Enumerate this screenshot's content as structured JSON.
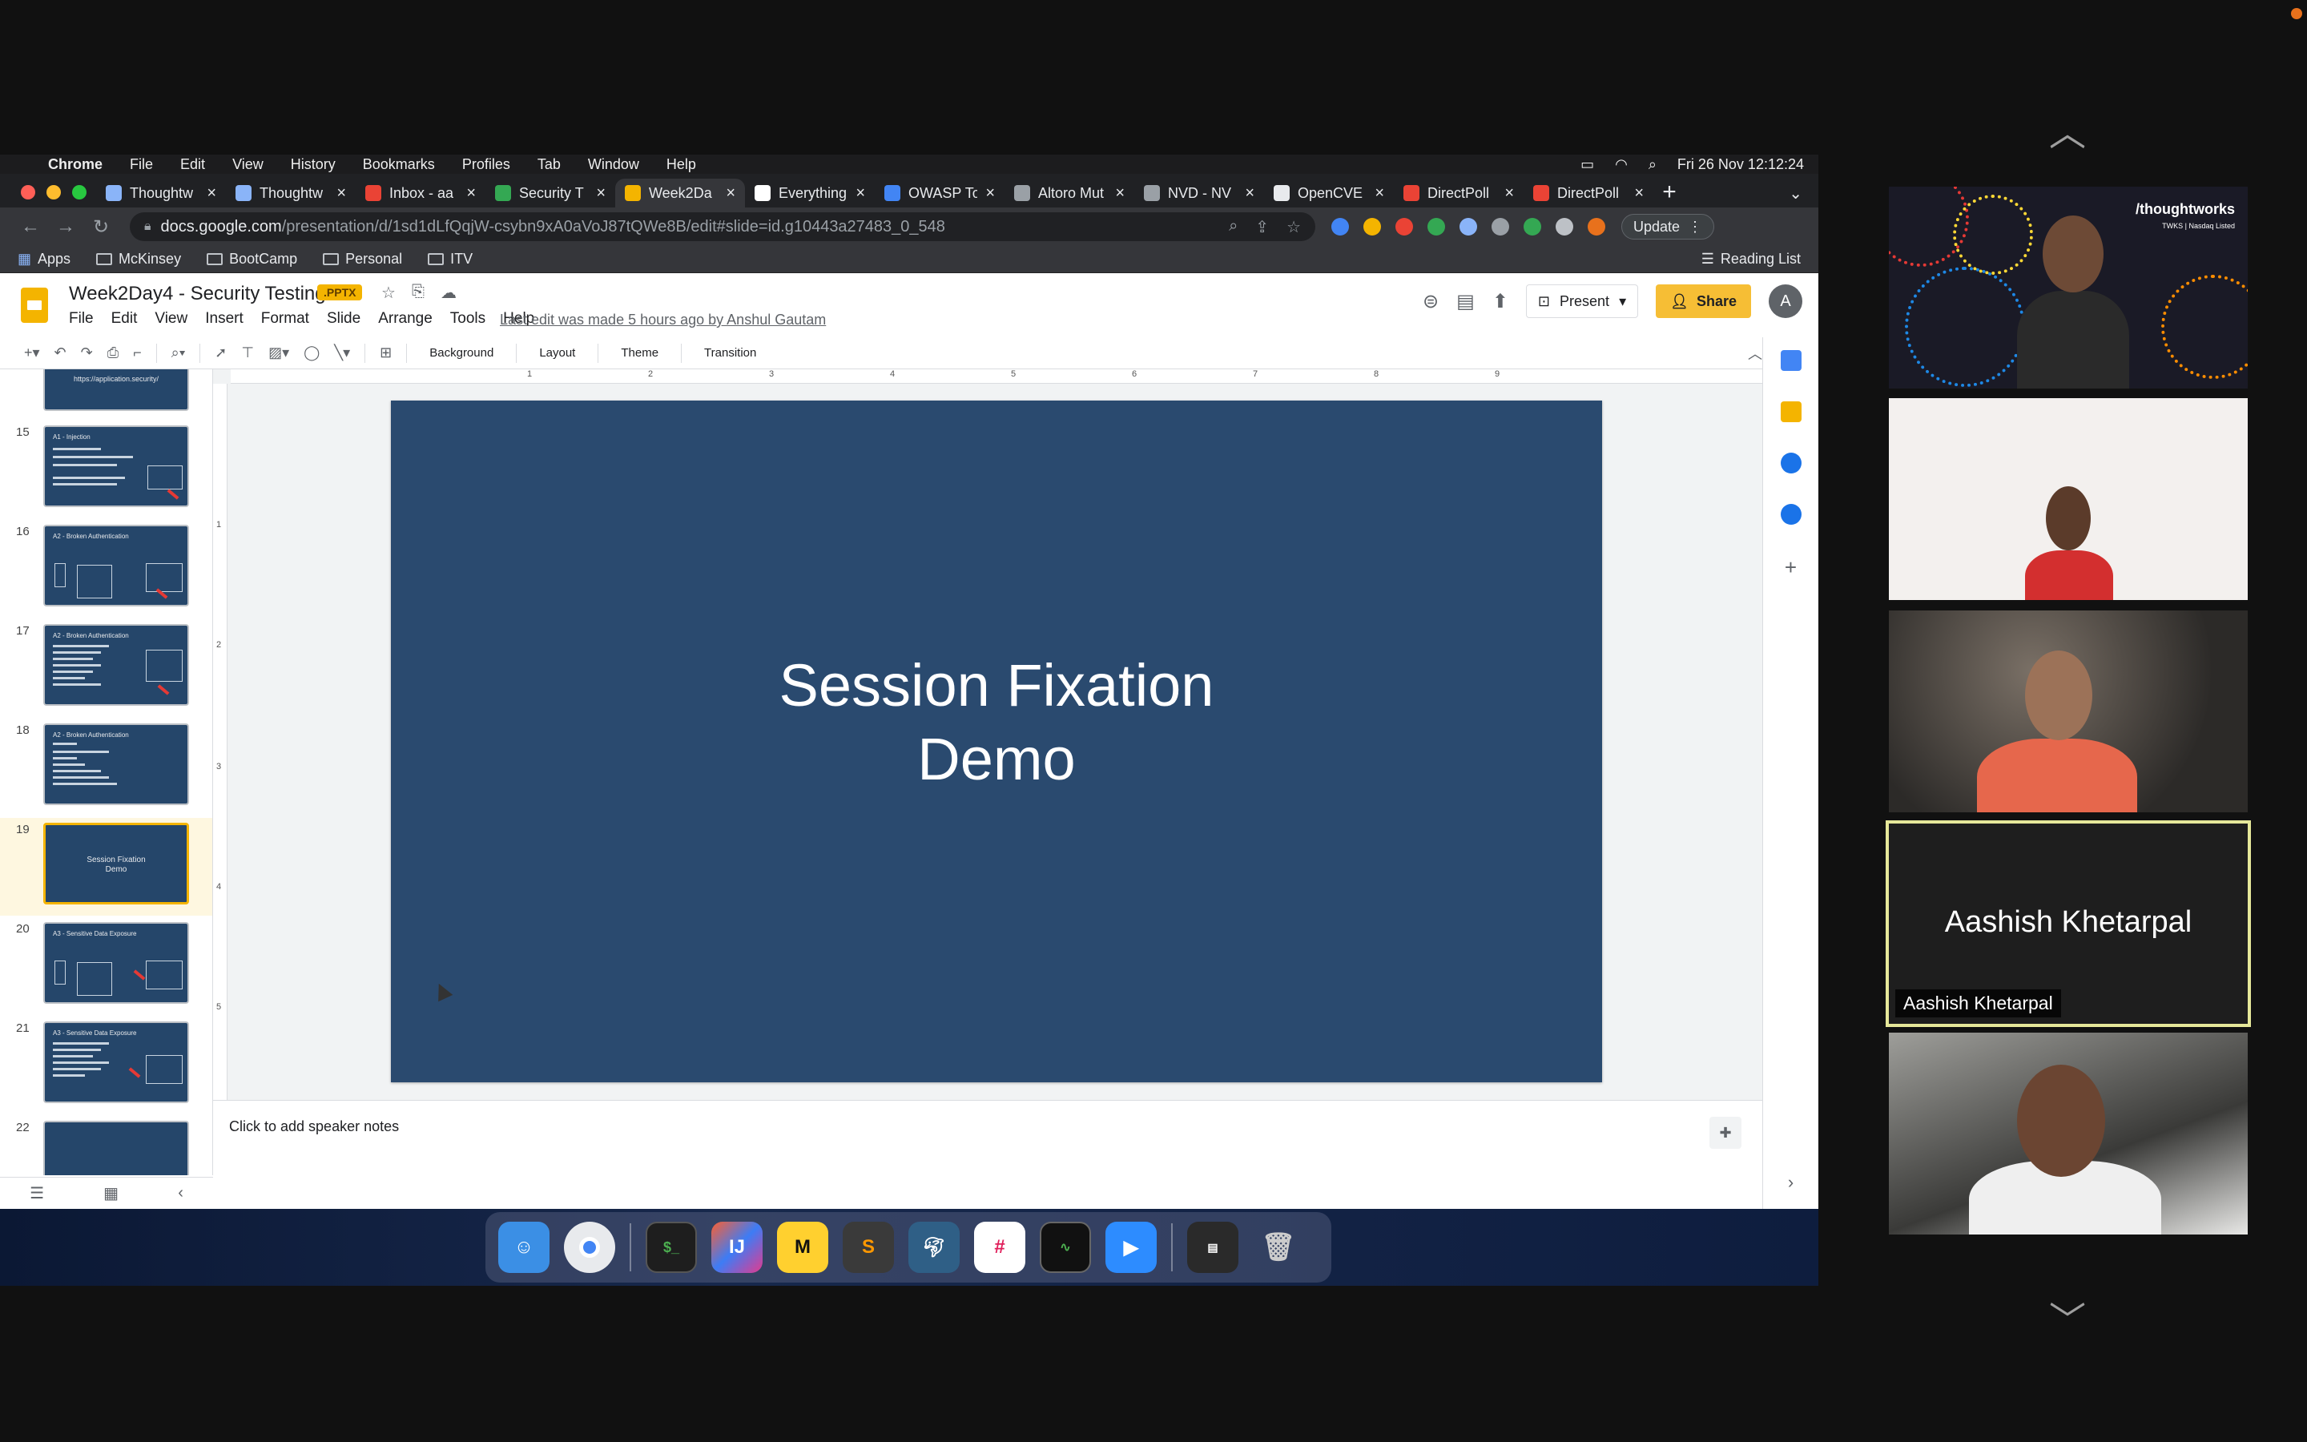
{
  "menubar": {
    "app": "Chrome",
    "items": [
      "File",
      "Edit",
      "View",
      "History",
      "Bookmarks",
      "Profiles",
      "Tab",
      "Window",
      "Help"
    ],
    "clock": "Fri 26 Nov  12:12:24"
  },
  "tabs": [
    {
      "label": "Thoughtw",
      "color": "#1a73e8"
    },
    {
      "label": "Thoughtw",
      "color": "#1a73e8"
    },
    {
      "label": "Inbox - aa",
      "color": "#ea4335"
    },
    {
      "label": "Security T",
      "color": "#34a853"
    },
    {
      "label": "Week2Da",
      "color": "#f4b400",
      "active": true
    },
    {
      "label": "Everything",
      "color": "#ffffff"
    },
    {
      "label": "OWASP To",
      "color": "#4285f4"
    },
    {
      "label": "Altoro Mut",
      "color": "#9aa0a6"
    },
    {
      "label": "NVD - NV",
      "color": "#9aa0a6"
    },
    {
      "label": "OpenCVE",
      "color": "#e8eaed"
    },
    {
      "label": "DirectPoll",
      "color": "#ea4335"
    },
    {
      "label": "DirectPoll",
      "color": "#ea4335"
    }
  ],
  "omnibox": {
    "host": "docs.google.com",
    "path": "/presentation/d/1sd1dLfQqjW-csybn9xA0aVoJ87tQWe8B/edit#slide=id.g10443a27483_0_548",
    "update_label": "Update"
  },
  "bookmarks": {
    "items": [
      "Apps",
      "McKinsey",
      "BootCamp",
      "Personal",
      "ITV"
    ],
    "reading_list": "Reading List"
  },
  "doc": {
    "title": "Week2Day4 - Security Testing",
    "badge": ".PPTX",
    "menu": [
      "File",
      "Edit",
      "View",
      "Insert",
      "Format",
      "Slide",
      "Arrange",
      "Tools",
      "Help"
    ],
    "last_edit": "Last edit was made 5 hours ago by Anshul Gautam",
    "present_label": "Present",
    "share_label": "Share",
    "avatar_letter": "A"
  },
  "toolbar": {
    "background": "Background",
    "layout": "Layout",
    "theme": "Theme",
    "transition": "Transition"
  },
  "ruler_h": [
    "1",
    "2",
    "3",
    "4",
    "5",
    "6",
    "7",
    "8",
    "9"
  ],
  "ruler_v": [
    "1",
    "2",
    "3",
    "4",
    "5"
  ],
  "filmstrip": {
    "partial_top_text": "https://application.security/",
    "slides": [
      {
        "num": "15",
        "title": "A1 - Injection"
      },
      {
        "num": "16",
        "title": "A2 - Broken Authentication"
      },
      {
        "num": "17",
        "title": "A2 - Broken Authentication"
      },
      {
        "num": "18",
        "title": "A2 - Broken Authentication"
      },
      {
        "num": "19",
        "title": "Session Fixation Demo",
        "selected": true
      },
      {
        "num": "20",
        "title": "A3 - Sensitive Data Exposure"
      },
      {
        "num": "21",
        "title": "A3 - Sensitive Data Exposure"
      },
      {
        "num": "22",
        "title": ""
      }
    ]
  },
  "slide": {
    "line1": "Session Fixation",
    "line2": "Demo",
    "background": "#2a4a6f"
  },
  "notes": {
    "placeholder": "Click to add speaker notes"
  },
  "gallery": {
    "brand": "/thoughtworks",
    "brand_sub": "TWKS | Nasdaq Listed",
    "active_speaker": "Aashish Khetarpal",
    "active_speaker_tag": "Aashish Khetarpal"
  }
}
